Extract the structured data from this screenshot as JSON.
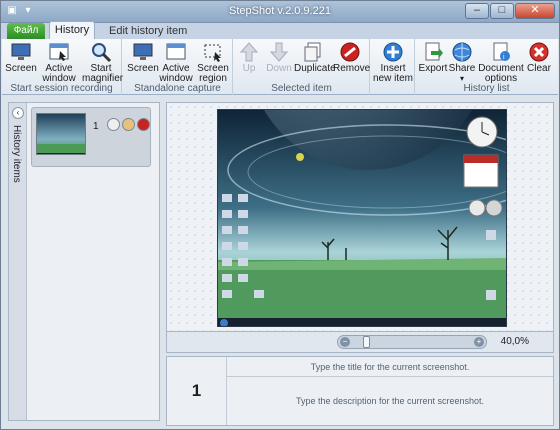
{
  "app": {
    "title": "StepShot v.2.0.9.221"
  },
  "ribbon": {
    "file_tab": "Файл",
    "tabs": [
      {
        "label": "History"
      },
      {
        "label": "Edit history item"
      }
    ],
    "groups": [
      {
        "label": "Start session recording",
        "buttons": [
          "Screen",
          "Active window",
          "Start magnifier"
        ]
      },
      {
        "label": "Standalone capture",
        "buttons": [
          "Screen",
          "Active window",
          "Screen region"
        ]
      },
      {
        "label": "Selected item",
        "buttons": [
          "Up",
          "Down",
          "Duplicate",
          "Remove"
        ]
      },
      {
        "label": "",
        "buttons": [
          "Insert new item"
        ]
      },
      {
        "label": "History list",
        "buttons": [
          "Export",
          "Share",
          "Document options",
          "Clear"
        ]
      }
    ]
  },
  "left_panel": {
    "vertical_tab": "History items",
    "items": [
      {
        "number": "1"
      }
    ]
  },
  "preview": {
    "zoom": "40,0%",
    "zoom_level": 0.1
  },
  "editor": {
    "number": "1",
    "title_placeholder": "Type the title for the current screenshot.",
    "description_placeholder": "Type the description for the current screenshot."
  }
}
